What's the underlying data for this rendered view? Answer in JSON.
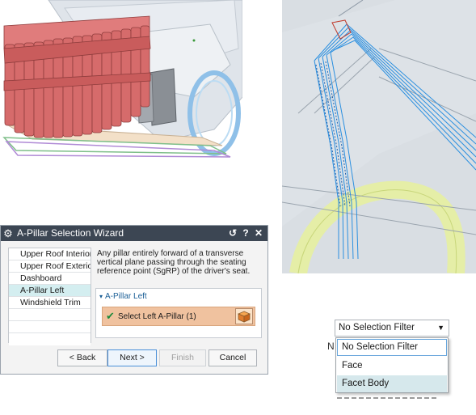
{
  "wizard": {
    "title": "A-Pillar Selection Wizard",
    "title_icon": "gear-icon",
    "reset_glyph": "↺",
    "help_glyph": "?",
    "close_glyph": "✕",
    "steps": [
      {
        "label": "Upper Roof Interior",
        "active": false
      },
      {
        "label": "Upper Roof Exterior",
        "active": false
      },
      {
        "label": "Dashboard",
        "active": false
      },
      {
        "label": "A-Pillar Left",
        "active": true
      },
      {
        "label": "Windshield Trim",
        "active": false
      }
    ],
    "description": "Any pillar entirely forward of a transverse vertical plane passing through the seating reference point (SgRP) of the driver's seat.",
    "group_title": "A-Pillar Left",
    "group_caret": "▾",
    "select_label": "Select Left A-Pillar (1)",
    "check_glyph": "✔",
    "buttons": {
      "back": "< Back",
      "next": "Next >",
      "finish": "Finish",
      "cancel": "Cancel"
    }
  },
  "selection_filter": {
    "current": "No Selection Filter",
    "arrow_glyph": "▼",
    "options": [
      "No Selection Filter",
      "Face",
      "Facet Body"
    ],
    "selected_index": 0,
    "hover_index": 2,
    "background_letter": "N"
  },
  "colors": {
    "titlebar": "#3c4653",
    "active_step": "#d4eef0",
    "selection_row": "#f0c29f",
    "seat_red": "#d66b6b",
    "wire_blue": "#2a8fe0",
    "steering_yellow": "#e6f0a0"
  }
}
